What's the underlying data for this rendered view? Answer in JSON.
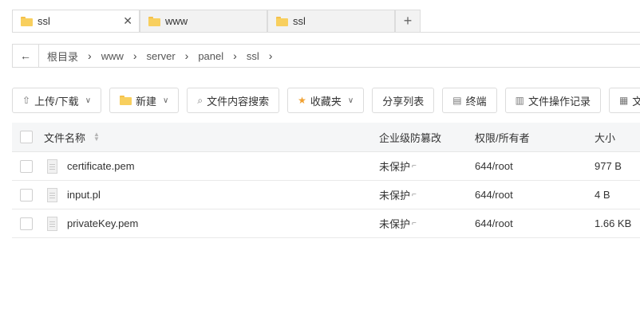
{
  "tabs": [
    {
      "label": "ssl",
      "active": true
    },
    {
      "label": "www",
      "active": false
    },
    {
      "label": "ssl",
      "active": false
    }
  ],
  "tab_close": "✕",
  "tab_add": "+",
  "breadcrumb": [
    "根目录",
    "www",
    "server",
    "panel",
    "ssl"
  ],
  "toolbar": {
    "upload": "上传/下载",
    "new": "新建",
    "search": "文件内容搜索",
    "favorites": "收藏夹",
    "share": "分享列表",
    "terminal": "终端",
    "oplog": "文件操作记录",
    "more": "文"
  },
  "table": {
    "headers": {
      "name": "文件名称",
      "protect": "企业级防篡改",
      "perm": "权限/所有者",
      "size": "大小"
    },
    "rows": [
      {
        "name": "certificate.pem",
        "protect": "未保护",
        "perm": "644/root",
        "size": "977 B"
      },
      {
        "name": "input.pl",
        "protect": "未保护",
        "perm": "644/root",
        "size": "4 B"
      },
      {
        "name": "privateKey.pem",
        "protect": "未保护",
        "perm": "644/root",
        "size": "1.66 KB"
      }
    ]
  },
  "colors": {
    "folder": "#f8cf5e",
    "border": "#dcdcdc",
    "header_bg": "#f5f6f7"
  }
}
